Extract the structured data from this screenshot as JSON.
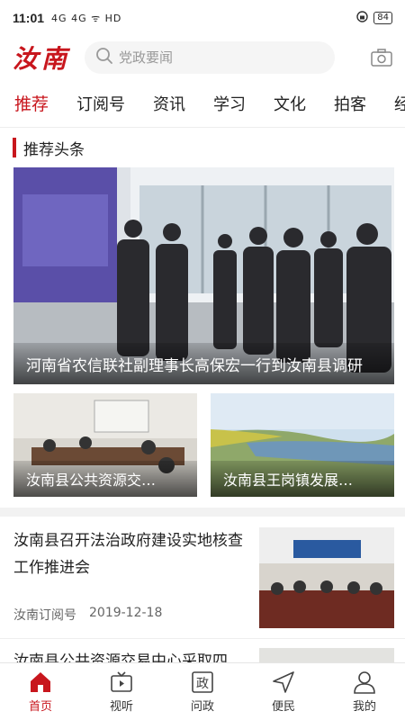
{
  "status_bar": {
    "time": "11:01",
    "signal": "4G 4G ᯤ HD",
    "battery": "84"
  },
  "header": {
    "logo": "汝南",
    "search_placeholder": "党政要闻"
  },
  "tabs": [
    "推荐",
    "订阅号",
    "资讯",
    "学习",
    "文化",
    "拍客",
    "经"
  ],
  "section": {
    "title": "推荐头条"
  },
  "hero": {
    "caption": "河南省农信联社副理事长高保宏一行到汝南县调研"
  },
  "thumbs": [
    {
      "caption": "汝南县公共资源交…"
    },
    {
      "caption": "汝南县王岗镇发展…"
    }
  ],
  "news": [
    {
      "headline": "汝南县召开法治政府建设实地核查工作推进会",
      "source": "汝南订阅号",
      "date": "2019-12-18"
    },
    {
      "headline": "汝南县公共资源交易中心采取四"
    }
  ],
  "bottom_nav": [
    {
      "label": "首页",
      "icon": "home-icon"
    },
    {
      "label": "视听",
      "icon": "tv-icon"
    },
    {
      "label": "问政",
      "icon": "zheng-icon"
    },
    {
      "label": "便民",
      "icon": "send-icon"
    },
    {
      "label": "我的",
      "icon": "user-icon"
    }
  ],
  "colors": {
    "accent": "#c8161d"
  }
}
